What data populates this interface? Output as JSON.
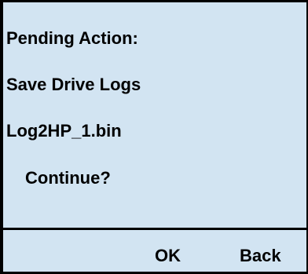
{
  "dialog": {
    "title": "Pending Action:",
    "action": "Save Drive Logs",
    "filename": "Log2HP_1.bin",
    "prompt": "Continue?"
  },
  "softkeys": {
    "ok_label": "OK",
    "back_label": "Back"
  },
  "colors": {
    "background": "#d2e4f2",
    "text": "#000000",
    "border": "#000000"
  }
}
